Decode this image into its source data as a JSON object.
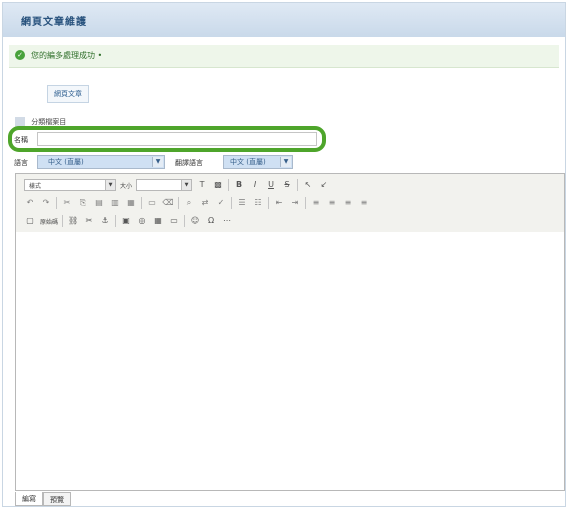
{
  "header": {
    "title": "網頁文章維護"
  },
  "notice": {
    "icon": "check-circle-icon",
    "message": "您的編多處理成功 •"
  },
  "tabs": [
    {
      "label": "網頁文章"
    }
  ],
  "category": {
    "label": "分類檔案目"
  },
  "form": {
    "name_label": "名稱",
    "name_value": "",
    "language_label": "語言",
    "language_value": "中文 (直屬)",
    "translation_label": "翻譯語言",
    "translation_value": "中文 (直屬)"
  },
  "toolbar": {
    "format_label": "樣式",
    "size_label": "大小",
    "source_label": "原始碼"
  },
  "footer": {
    "tabs": [
      {
        "label": "編寫"
      },
      {
        "label": "預覽"
      }
    ]
  },
  "colors": {
    "highlight": "#4ea52b",
    "header_bg": "#c9d9ea",
    "notice_bg": "#eef6ea"
  }
}
